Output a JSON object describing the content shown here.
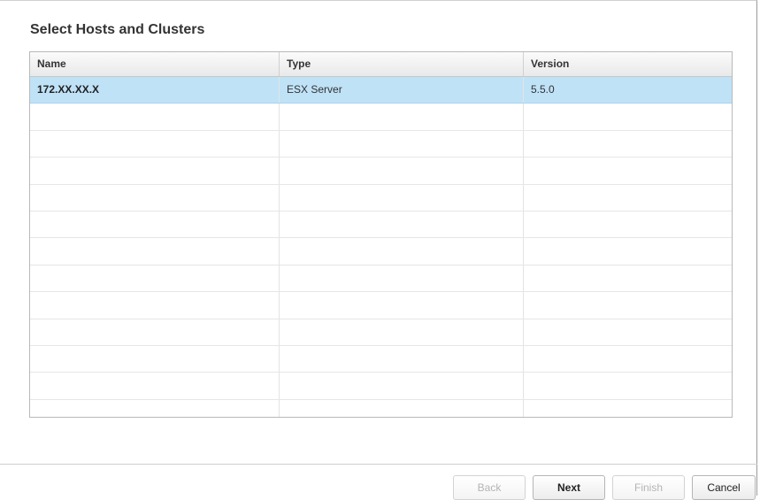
{
  "dialog": {
    "title": "Select Hosts and Clusters"
  },
  "table": {
    "columns": [
      "Name",
      "Type",
      "Version"
    ],
    "rows": [
      {
        "name": "172.XX.XX.X",
        "type": "ESX Server",
        "version": "5.5.0",
        "selected": true
      },
      {
        "name": "",
        "type": "",
        "version": ""
      },
      {
        "name": "",
        "type": "",
        "version": ""
      },
      {
        "name": "",
        "type": "",
        "version": ""
      },
      {
        "name": "",
        "type": "",
        "version": ""
      },
      {
        "name": "",
        "type": "",
        "version": ""
      },
      {
        "name": "",
        "type": "",
        "version": ""
      },
      {
        "name": "",
        "type": "",
        "version": ""
      },
      {
        "name": "",
        "type": "",
        "version": ""
      },
      {
        "name": "",
        "type": "",
        "version": ""
      },
      {
        "name": "",
        "type": "",
        "version": ""
      },
      {
        "name": "",
        "type": "",
        "version": ""
      },
      {
        "name": "",
        "type": "",
        "version": ""
      }
    ]
  },
  "buttons": {
    "back": "Back",
    "next": "Next",
    "finish": "Finish",
    "cancel": "Cancel"
  },
  "colors": {
    "selected_row": "#bfe2f7",
    "disabled_text": "#b4b4b4"
  }
}
